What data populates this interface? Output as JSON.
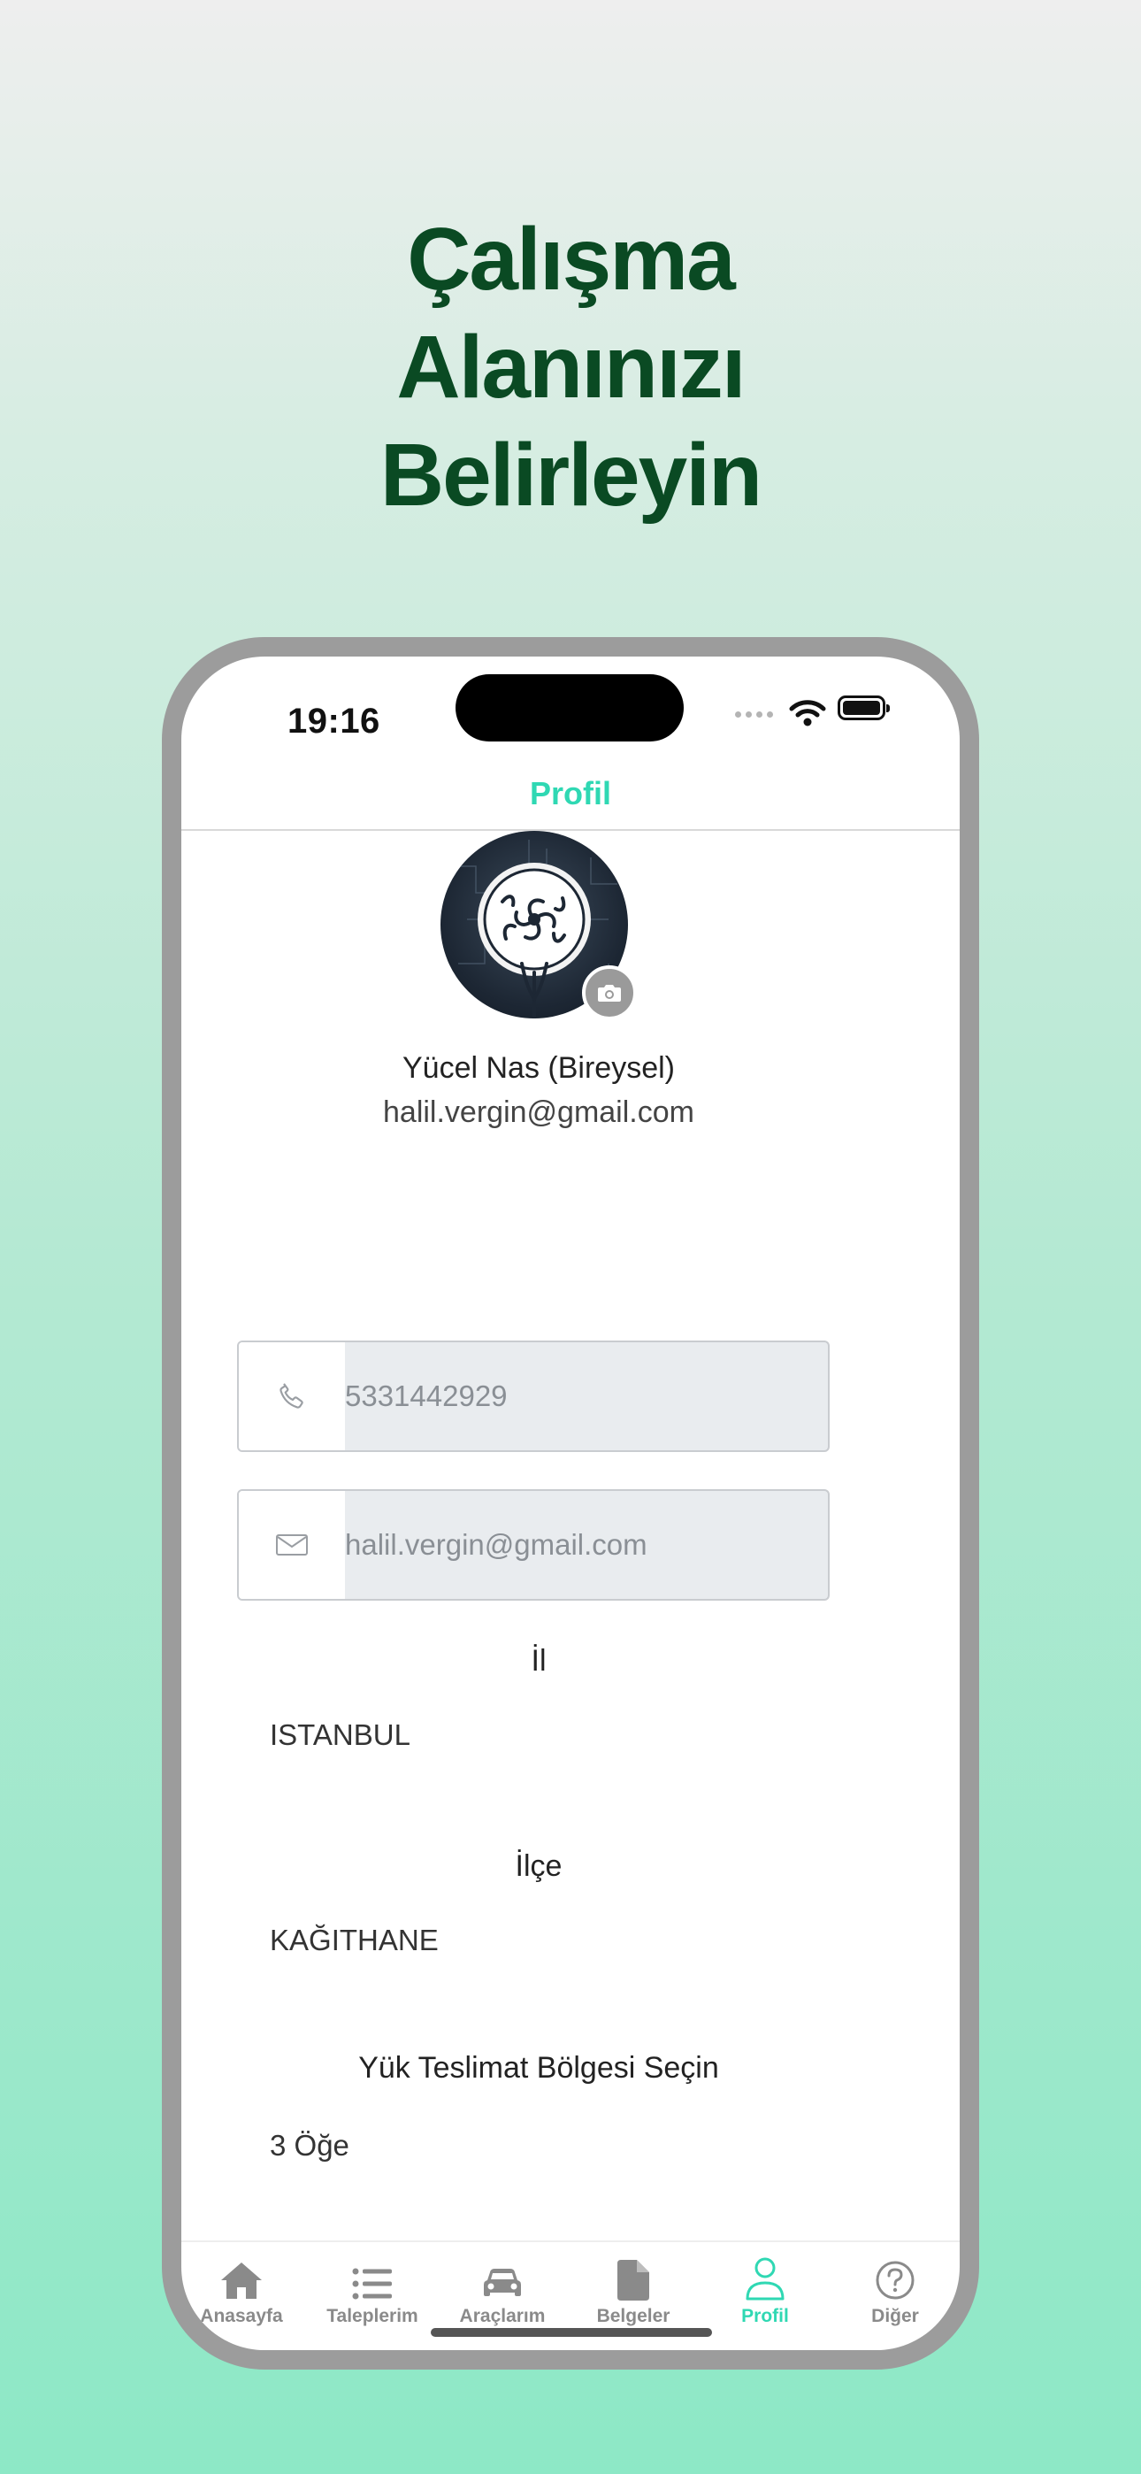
{
  "headline": {
    "lines": [
      "Çalışma",
      "Alanınızı",
      "Belirleyin"
    ]
  },
  "status_bar": {
    "time": "19:16"
  },
  "nav": {
    "title": "Profil"
  },
  "profile": {
    "name": "Yücel Nas (Bireysel)",
    "email": "halil.vergin@gmail.com"
  },
  "fields": {
    "phone": {
      "icon": "phone-icon",
      "value": "5331442929"
    },
    "email": {
      "icon": "mail-icon",
      "value": "halil.vergin@gmail.com"
    }
  },
  "location": {
    "province_label": "İl",
    "province_value": "ISTANBUL",
    "district_label": "İlçe",
    "district_value": "KAĞITHANE",
    "region_label": "Yük Teslimat Bölgesi Seçin",
    "region_value": "3 Öğe"
  },
  "tabs": [
    {
      "label": "Anasayfa",
      "icon": "home-icon"
    },
    {
      "label": "Taleplerim",
      "icon": "list-icon"
    },
    {
      "label": "Araçlarım",
      "icon": "car-icon"
    },
    {
      "label": "Belgeler",
      "icon": "document-icon"
    },
    {
      "label": "Profil",
      "icon": "person-icon"
    },
    {
      "label": "Diğer",
      "icon": "question-icon"
    }
  ],
  "colors": {
    "accent": "#2fd8b3",
    "headline": "#0a4a23",
    "tab_inactive": "#8a8a8a"
  }
}
